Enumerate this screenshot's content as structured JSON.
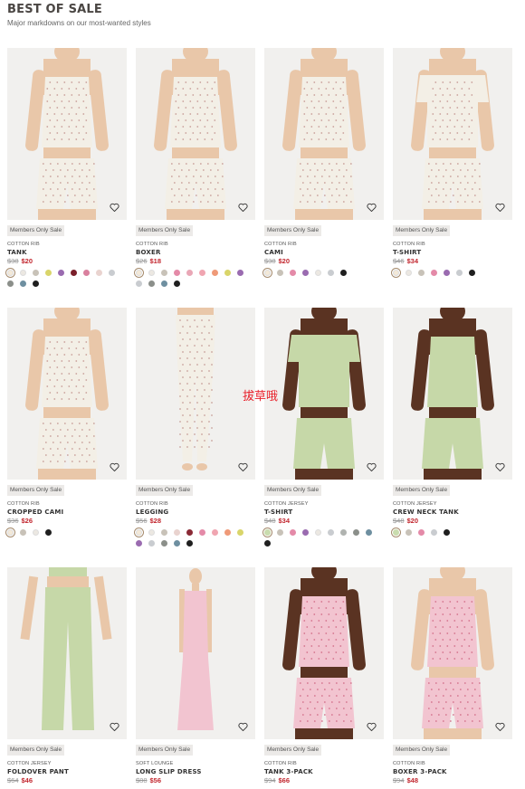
{
  "header": {
    "title": "BEST OF SALE",
    "subtitle": "Major markdowns on our most-wanted styles"
  },
  "overlay_text": "拔草哦",
  "products": [
    {
      "badge": "Members Only Sale",
      "fabric": "COTTON RIB",
      "name": "TANK",
      "old_price": "$38",
      "new_price": "$20",
      "model": "white-tank-shorts",
      "swatches": [
        "#f4e9d7",
        "#ece8e2",
        "#c8c2b8",
        "#d9d56a",
        "#9a6bb0",
        "#7a1f2b",
        "#d9809e",
        "#e9d3cf",
        "#c9ccd0",
        "#8b8f8a",
        "#6e8fa0",
        "#1f1f1f"
      ]
    },
    {
      "badge": "Members Only Sale",
      "fabric": "COTTON RIB",
      "name": "BOXER",
      "old_price": "$26",
      "new_price": "$18",
      "model": "white-tank-shorts",
      "swatches": [
        "#f4e9d7",
        "#ece8e2",
        "#c8c2b8",
        "#e48aa8",
        "#e9a7b6",
        "#f0a5b1",
        "#ef9a78",
        "#d9d56a",
        "#9a6bb0",
        "#c9ccd0",
        "#8b8f8a",
        "#6e8fa0",
        "#1f1f1f"
      ]
    },
    {
      "badge": "Members Only Sale",
      "fabric": "COTTON RIB",
      "name": "CAMI",
      "old_price": "$38",
      "new_price": "$20",
      "model": "white-cami",
      "swatches": [
        "#f4e9d7",
        "#c8c2b8",
        "#e48aa8",
        "#9a6bb0",
        "#ece8e2",
        "#c9ccd0",
        "#1f1f1f"
      ]
    },
    {
      "badge": "Members Only Sale",
      "fabric": "COTTON RIB",
      "name": "T-SHIRT",
      "old_price": "$46",
      "new_price": "$34",
      "model": "white-tee",
      "swatches": [
        "#f4e9d7",
        "#ece8e2",
        "#c8c2b8",
        "#e48aa8",
        "#9a6bb0",
        "#c9ccd0",
        "#1f1f1f"
      ]
    },
    {
      "badge": "Members Only Sale",
      "fabric": "COTTON RIB",
      "name": "CROPPED CAMI",
      "old_price": "$36",
      "new_price": "$26",
      "model": "white-cami",
      "swatches": [
        "#f4e9d7",
        "#c8c2b8",
        "#ece8e2",
        "#1f1f1f"
      ]
    },
    {
      "badge": "Members Only Sale",
      "fabric": "COTTON RIB",
      "name": "LEGGING",
      "old_price": "$56",
      "new_price": "$28",
      "model": "white-legging",
      "swatches": [
        "#f4e9d7",
        "#ece8e2",
        "#c8c2b8",
        "#e9d3cf",
        "#8a2a36",
        "#e48aa8",
        "#f0a5b1",
        "#ef9a78",
        "#d9d56a",
        "#9a6bb0",
        "#c9ccd0",
        "#8b8f8a",
        "#6e8fa0",
        "#1f1f1f"
      ]
    },
    {
      "badge": "Members Only Sale",
      "fabric": "COTTON JERSEY",
      "name": "T-SHIRT",
      "old_price": "$48",
      "new_price": "$34",
      "model": "green-tee",
      "swatches": [
        "#c9dcae",
        "#c8c2b8",
        "#e48aa8",
        "#9a6bb0",
        "#ece8e2",
        "#c9ccd0",
        "#b0b3b0",
        "#8b8f8a",
        "#6e8fa0",
        "#1f1f1f"
      ]
    },
    {
      "badge": "Members Only Sale",
      "fabric": "COTTON JERSEY",
      "name": "CREW NECK TANK",
      "old_price": "$48",
      "new_price": "$20",
      "model": "green-tank",
      "swatches": [
        "#c9dcae",
        "#c8c2b8",
        "#e48aa8",
        "#c9ccd0",
        "#1f1f1f"
      ]
    },
    {
      "badge": "Members Only Sale",
      "fabric": "COTTON JERSEY",
      "name": "FOLDOVER PANT",
      "old_price": "$64",
      "new_price": "$46",
      "model": "green-pant",
      "swatches": []
    },
    {
      "badge": "Members Only Sale",
      "fabric": "SOFT LOUNGE",
      "name": "LONG SLIP DRESS",
      "old_price": "$88",
      "new_price": "$56",
      "model": "pink-dress",
      "swatches": []
    },
    {
      "badge": "Members Only Sale",
      "fabric": "COTTON RIB",
      "name": "TANK 3-PACK",
      "old_price": "$94",
      "new_price": "$66",
      "model": "pink-tank",
      "swatches": []
    },
    {
      "badge": "Members Only Sale",
      "fabric": "COTTON RIB",
      "name": "BOXER 3-PACK",
      "old_price": "$94",
      "new_price": "$48",
      "model": "pink-shorts",
      "swatches": []
    }
  ],
  "icons": {
    "wishlist": "heart-icon",
    "swatch": "color-swatch"
  },
  "colors": {
    "sale_price": "#c2262e",
    "badge_bg": "#eceae8",
    "title": "#4a4643"
  }
}
